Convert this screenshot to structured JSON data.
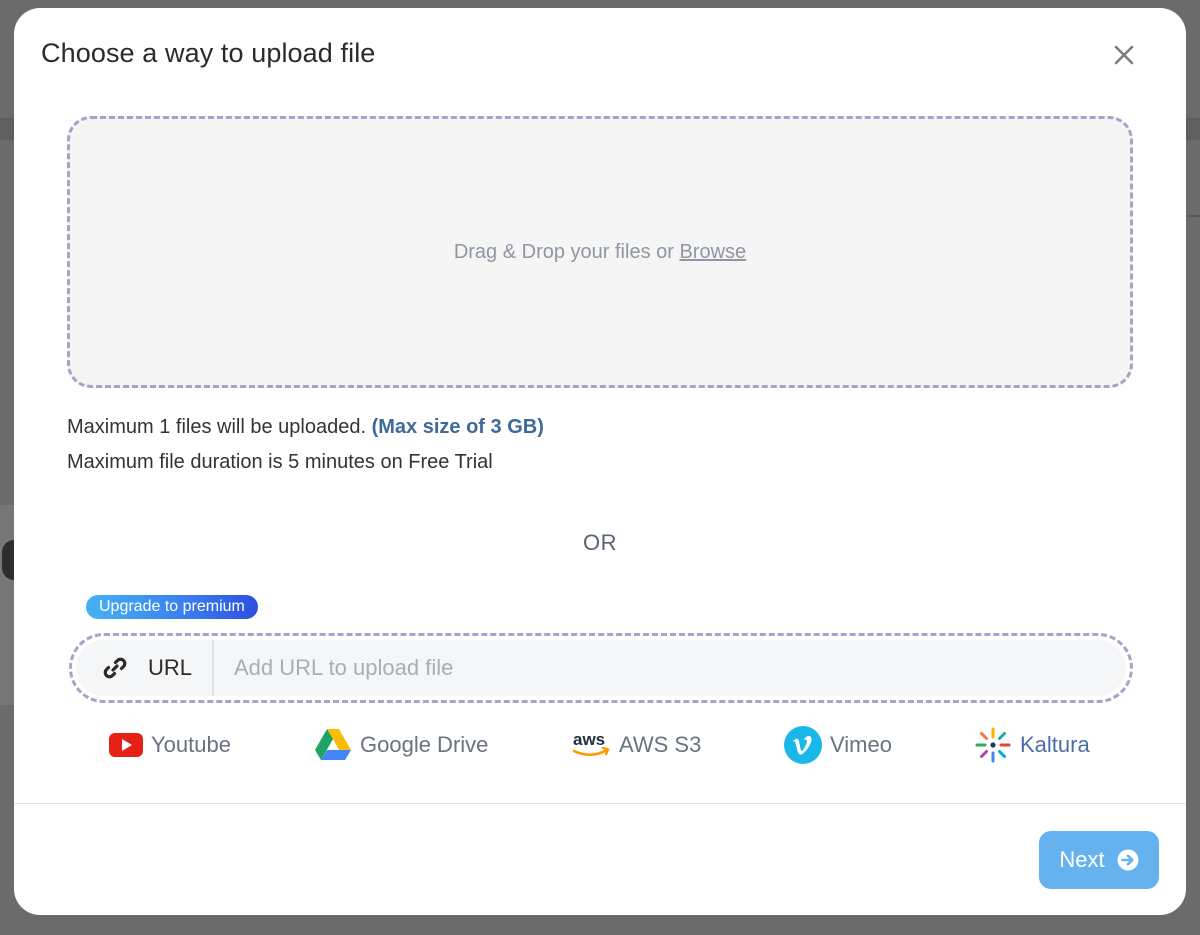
{
  "modal": {
    "title": "Choose a way to upload file"
  },
  "dropzone": {
    "text": "Drag & Drop your files or ",
    "browse_label": "Browse"
  },
  "limits": {
    "max_files": "Maximum 1 files will be uploaded.",
    "max_size": "(Max size of 3 GB)",
    "duration": "Maximum file duration is 5 minutes on Free Trial"
  },
  "separator": "OR",
  "url_upload": {
    "badge": "Upgrade to premium",
    "label": "URL",
    "placeholder": "Add URL to upload file"
  },
  "sources": [
    {
      "label": "Youtube",
      "icon": "youtube-icon"
    },
    {
      "label": "Google Drive",
      "icon": "google-drive-icon"
    },
    {
      "label": "AWS S3",
      "icon": "aws-icon"
    },
    {
      "label": "Vimeo",
      "icon": "vimeo-icon"
    },
    {
      "label": "Kaltura",
      "icon": "kaltura-icon"
    }
  ],
  "footer": {
    "next_label": "Next"
  },
  "colors": {
    "accent": "#65b2ee",
    "dashed_border": "#a8a3c6",
    "link_blue": "#3f6a98"
  }
}
